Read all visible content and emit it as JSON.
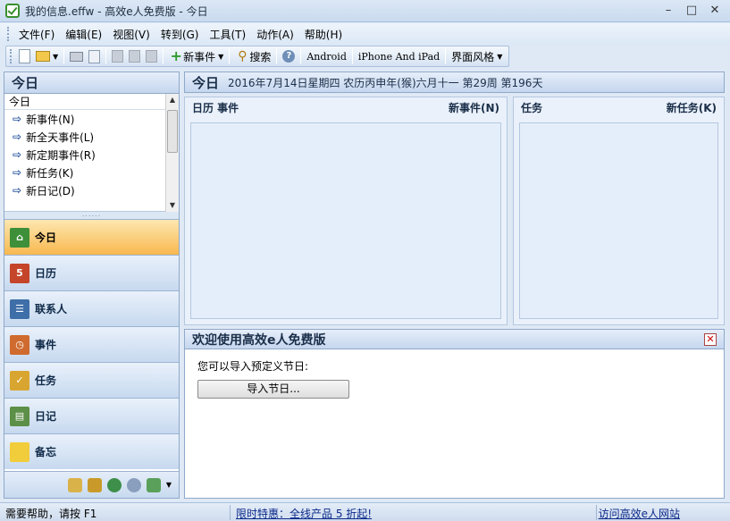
{
  "window": {
    "title": "我的信息.effw - 高效e人免费版 - 今日",
    "minimize": "–",
    "maximize": "□",
    "close": "✕"
  },
  "menu": [
    "文件(F)",
    "编辑(E)",
    "视图(V)",
    "转到(G)",
    "工具(T)",
    "动作(A)",
    "帮助(H)"
  ],
  "toolbar": {
    "new_event": "新事件",
    "search": "搜索",
    "android": "Android",
    "iphone": "iPhone And iPad",
    "theme": "界面风格"
  },
  "left": {
    "header": "今日",
    "list_title": "今日",
    "actions": [
      "新事件(N)",
      "新全天事件(L)",
      "新定期事件(R)",
      "新任务(K)",
      "新日记(D)"
    ],
    "splitter": "......",
    "nav": [
      {
        "label": "今日",
        "icon": "home-icon",
        "active": true
      },
      {
        "label": "日历",
        "icon": "calendar-icon",
        "active": false
      },
      {
        "label": "联系人",
        "icon": "contact-card-icon",
        "active": false
      },
      {
        "label": "事件",
        "icon": "event-icon",
        "active": false
      },
      {
        "label": "任务",
        "icon": "task-clipboard-icon",
        "active": false
      },
      {
        "label": "日记",
        "icon": "diary-book-icon",
        "active": false
      },
      {
        "label": "备忘",
        "icon": "memo-note-icon",
        "active": false
      }
    ]
  },
  "today_header": {
    "title": "今日",
    "date": "2016年7月14日星期四  农历丙申年(猴)六月十一  第29周  第196天"
  },
  "calendar_panel": {
    "title": "日历  事件",
    "action": "新事件(N)"
  },
  "task_panel": {
    "title": "任务",
    "action": "新任务(K)"
  },
  "welcome": {
    "title": "欢迎使用高效e人免费版",
    "text": "您可以导入预定义节日:",
    "button": "导入节日..."
  },
  "status": {
    "help": "需要帮助，请按 F1",
    "promo": "限时特惠：全线产品 5 折起!",
    "visit": "访问高效e人网站"
  },
  "colors": {
    "accent": "#f8b84f",
    "panel_bg": "#eaf1fb",
    "header_text": "#1a2e48"
  }
}
